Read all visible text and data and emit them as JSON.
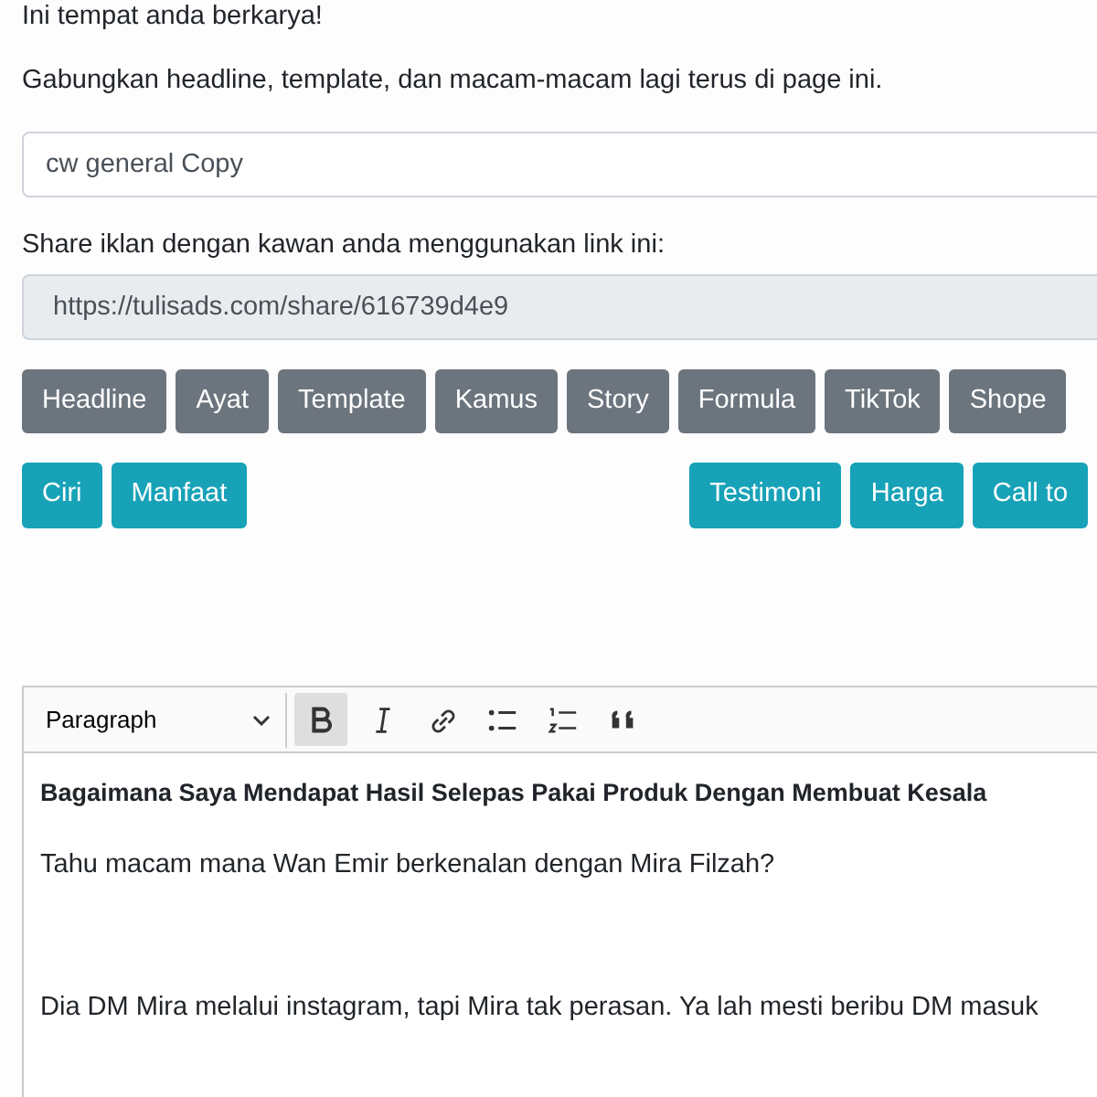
{
  "intro": "Ini tempat anda berkarya!",
  "subtitle": "Gabungkan headline, template, dan macam-macam lagi terus di page ini.",
  "name_field": {
    "value": "cw general Copy"
  },
  "share": {
    "label": "Share iklan dengan kawan anda menggunakan link ini:",
    "value": "https://tulisads.com/share/616739d4e9"
  },
  "category_buttons": [
    "Headline",
    "Ayat",
    "Template",
    "Kamus",
    "Story",
    "Formula",
    "TikTok",
    "Shope"
  ],
  "section_buttons_left": [
    "Ciri",
    "Manfaat"
  ],
  "section_buttons_right": [
    "Testimoni",
    "Harga",
    "Call to"
  ],
  "editor": {
    "block_format": "Paragraph",
    "tools": [
      {
        "kind": "bold",
        "active": true
      },
      {
        "kind": "italic",
        "active": false
      },
      {
        "kind": "link",
        "active": false
      },
      {
        "kind": "bulleted-list",
        "active": false
      },
      {
        "kind": "numbered-list",
        "active": false
      },
      {
        "kind": "quote",
        "active": false
      }
    ],
    "paragraphs": [
      {
        "kind": "heading",
        "text": "Bagaimana Saya Mendapat Hasil Selepas Pakai Produk Dengan Membuat Kesala"
      },
      {
        "kind": "text",
        "text": "Tahu macam mana Wan Emir berkenalan dengan Mira Filzah?"
      },
      {
        "kind": "blank"
      },
      {
        "kind": "text",
        "text": "Dia DM Mira melalui instagram, tapi Mira tak perasan. Ya lah mesti beribu DM masuk"
      }
    ]
  }
}
